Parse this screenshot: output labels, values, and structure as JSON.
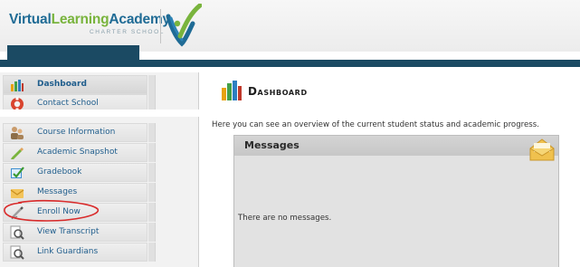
{
  "brand": {
    "name_part1": "Virtual",
    "name_part2": "Learning",
    "name_part3": "Academy",
    "subtitle": "CHARTER SCHOOL"
  },
  "sidebar": {
    "items": [
      {
        "label": "Dashboard",
        "icon": "dashboard-chart-icon",
        "active": true
      },
      {
        "label": "Contact School",
        "icon": "contact-lifebuoy-icon"
      },
      {
        "label": "Course Information",
        "icon": "course-people-icon"
      },
      {
        "label": "Academic Snapshot",
        "icon": "snapshot-pencil-icon"
      },
      {
        "label": "Gradebook",
        "icon": "gradebook-check-icon"
      },
      {
        "label": "Messages",
        "icon": "messages-envelope-icon"
      },
      {
        "label": "Enroll Now",
        "icon": "enroll-pen-icon"
      },
      {
        "label": "View Transcript",
        "icon": "transcript-magnifier-icon"
      },
      {
        "label": "Link Guardians",
        "icon": "guardians-magnifier-icon"
      }
    ]
  },
  "main": {
    "title": "Dashboard",
    "overview": "Here you can see an overview of the current student status and academic progress.",
    "messages": {
      "title": "Messages",
      "empty_text": "There are no messages."
    }
  },
  "colors": {
    "nav_bar": "#1b4a63",
    "link_text": "#1f5d8c",
    "brand_blue": "#1f6b95",
    "brand_green": "#79b43d",
    "annotation_red": "#d92b2b"
  }
}
